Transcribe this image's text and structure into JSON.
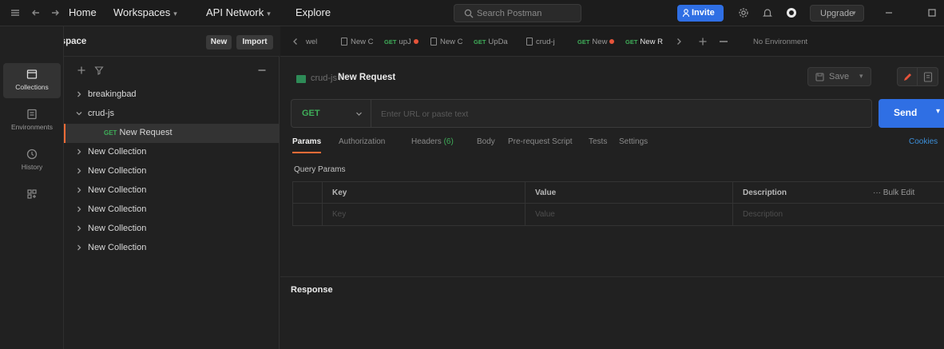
{
  "topbar": {
    "nav": [
      {
        "label": "Home",
        "has_caret": false
      },
      {
        "label": "Workspaces",
        "has_caret": true
      },
      {
        "label": "API Network",
        "has_caret": true
      },
      {
        "label": "Explore",
        "has_caret": false
      }
    ],
    "search_placeholder": "Search Postman",
    "invite_label": "Invite",
    "upgrade_label": "Upgrade"
  },
  "workspace": {
    "title": "My Workspace",
    "new_label": "New",
    "import_label": "Import"
  },
  "rail": [
    {
      "label": "Collections",
      "icon": "collections-icon",
      "active": true
    },
    {
      "label": "Environments",
      "icon": "environments-icon",
      "active": false
    },
    {
      "label": "History",
      "icon": "history-icon",
      "active": false
    },
    {
      "label": "",
      "icon": "apps-icon",
      "active": false
    }
  ],
  "sidebar": {
    "items": [
      {
        "label": "breakingbad",
        "expanded": false,
        "type": "collection"
      },
      {
        "label": "crud-js",
        "expanded": true,
        "type": "collection"
      },
      {
        "label": "New Request",
        "method": "GET",
        "type": "request",
        "selected": true
      },
      {
        "label": "New Collection",
        "expanded": false,
        "type": "collection"
      },
      {
        "label": "New Collection",
        "expanded": false,
        "type": "collection"
      },
      {
        "label": "New Collection",
        "expanded": false,
        "type": "collection"
      },
      {
        "label": "New Collection",
        "expanded": false,
        "type": "collection"
      },
      {
        "label": "New Collection",
        "expanded": false,
        "type": "collection"
      },
      {
        "label": "New Collection",
        "expanded": false,
        "type": "collection"
      }
    ]
  },
  "tabs": [
    {
      "label": "wel",
      "method": "",
      "dot": false
    },
    {
      "label": "New C",
      "method": "",
      "dot": false,
      "doc": true
    },
    {
      "label": "upJ",
      "method": "GET",
      "dot": true
    },
    {
      "label": "New C",
      "method": "",
      "dot": false,
      "doc": true
    },
    {
      "label": "UpDa",
      "method": "GET",
      "dot": false
    },
    {
      "label": "crud-j",
      "method": "",
      "dot": false,
      "doc": true
    },
    {
      "label": "New",
      "method": "GET",
      "dot": true
    },
    {
      "label": "New R",
      "method": "GET",
      "dot": false
    }
  ],
  "environment": "No Environment",
  "request": {
    "breadcrumb": "crud-js /",
    "name": "New Request",
    "save_label": "Save",
    "method": "GET",
    "url_placeholder": "Enter URL or paste text",
    "send_label": "Send",
    "tabs": [
      {
        "label": "Params",
        "active": true,
        "count": ""
      },
      {
        "label": "Authorization",
        "active": false,
        "count": ""
      },
      {
        "label": "Headers",
        "active": false,
        "count": "(6)"
      },
      {
        "label": "Body",
        "active": false,
        "count": ""
      },
      {
        "label": "Pre-request Script",
        "active": false,
        "count": ""
      },
      {
        "label": "Tests",
        "active": false,
        "count": ""
      },
      {
        "label": "Settings",
        "active": false,
        "count": ""
      }
    ],
    "cookies_label": "Cookies",
    "query_params_label": "Query Params",
    "table": {
      "headers": [
        "Key",
        "Value",
        "Description"
      ],
      "placeholders": [
        "Key",
        "Value",
        "Description"
      ],
      "bulk_edit_label": "Bulk Edit"
    }
  },
  "response": {
    "label": "Response"
  },
  "colors": {
    "accent_orange": "#ff6c37",
    "primary_blue": "#2f6fe4",
    "get_green": "#3fae59",
    "unsaved_dot": "#e6543a"
  }
}
